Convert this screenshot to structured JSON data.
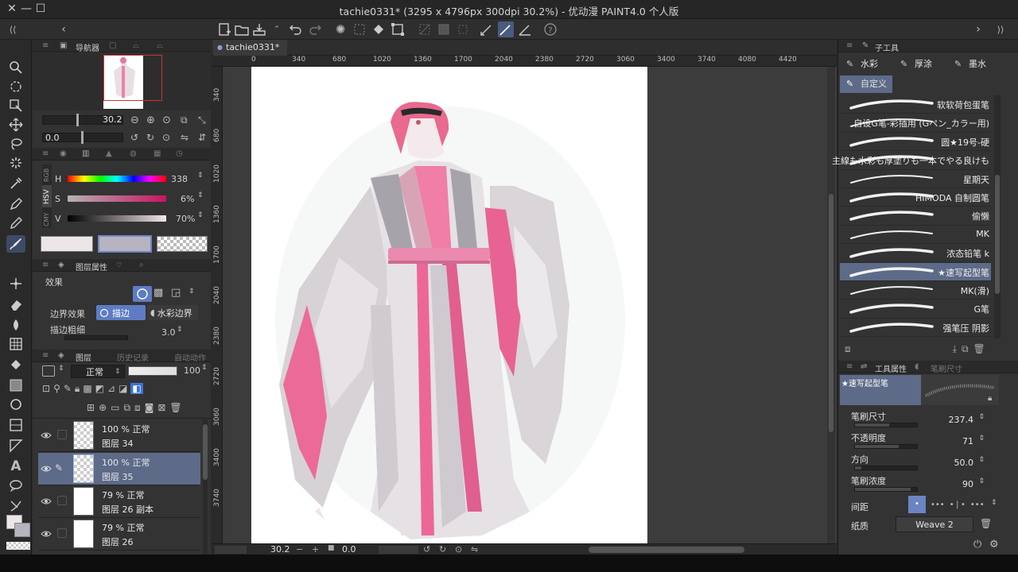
{
  "window": {
    "title": "tachie0331* (3295 x 4796px 300dpi 30.2%) - 优动漫 PAINT4.0 个人版"
  },
  "navigator": {
    "tab_label": "导航器",
    "zoom": "30.2",
    "rotation": "0.0"
  },
  "color": {
    "mode_rgb": "RGB",
    "mode_hsv": "HSV",
    "mode_cmy": "CMY",
    "h_label": "H",
    "h_value": "338",
    "s_label": "S",
    "s_value": "6%",
    "v_label": "V",
    "v_value": "70%",
    "main_color": "#ece6e8",
    "sub_color": "#b7b3bf"
  },
  "layer_props": {
    "tab_label": "图层属性",
    "effect_label": "效果",
    "border_effect_label": "边界效果",
    "opt_outline": "描边",
    "opt_watercolor": "水彩边界",
    "border_width_label": "描边粗细",
    "border_width_value": "3.0"
  },
  "layers_panel": {
    "tab_label": "图层",
    "history_label": "历史记录",
    "auto_action_label": "自动动作",
    "blend_mode": "正常",
    "opacity": "100",
    "layers": [
      {
        "opacity": "100 %  正常",
        "name": "图层 34",
        "selected": false,
        "thumb": "check"
      },
      {
        "opacity": "100 %  正常",
        "name": "图层 35",
        "selected": true,
        "thumb": "check"
      },
      {
        "opacity": "79 %  正常",
        "name": "图层 26 副本",
        "selected": false,
        "thumb": "white"
      },
      {
        "opacity": "79 %  正常",
        "name": "图层 26",
        "selected": false,
        "thumb": "white"
      }
    ]
  },
  "canvas": {
    "tab_label": "tachie0331*",
    "ruler_h": [
      "0",
      "340",
      "680",
      "1020",
      "1360",
      "1700",
      "2040",
      "2380",
      "2720",
      "3060",
      "3400",
      "3740",
      "4080",
      "4420"
    ],
    "ruler_v": [
      "340",
      "680",
      "1020",
      "1360",
      "1700",
      "2040",
      "2380",
      "2720",
      "3060",
      "3400",
      "3740"
    ],
    "zoom": "30.2",
    "rotation": "0.0"
  },
  "sub_tool": {
    "tab_label": "子工具",
    "tabs": [
      "水彩",
      "厚涂",
      "墨水",
      "自定义"
    ],
    "brushes": [
      {
        "name": "软软荷包蛋笔",
        "selected": false
      },
      {
        "name": "自设G笔-彩插用 (Gペン_カラー用)",
        "selected": false
      },
      {
        "name": "圆★19号-硬",
        "selected": false
      },
      {
        "name": "主線も水彩も厚塗りも一本でやる良けも",
        "selected": false
      },
      {
        "name": "星期天",
        "selected": false
      },
      {
        "name": "HIMODA 自制圆笔",
        "selected": false
      },
      {
        "name": "偷懒",
        "selected": false
      },
      {
        "name": "MK",
        "selected": false
      },
      {
        "name": "浓态铅笔 k",
        "selected": false
      },
      {
        "name": "★速写起型笔",
        "selected": true
      },
      {
        "name": "MK(滑)",
        "selected": false
      },
      {
        "name": "G笔",
        "selected": false
      },
      {
        "name": "强笔压 阴影",
        "selected": false
      }
    ]
  },
  "tool_props": {
    "tab_label": "工具属性",
    "tab2_label": "笔刷尺寸",
    "preset_name": "★速写起型笔",
    "props": [
      {
        "label": "笔刷尺寸",
        "value": "237.4",
        "fraction": 0.55
      },
      {
        "label": "不透明度",
        "value": "71",
        "fraction": 0.71
      },
      {
        "label": "方向",
        "value": "50.0",
        "fraction": 0.1
      },
      {
        "label": "笔刷浓度",
        "value": "90",
        "fraction": 0.9
      }
    ],
    "spacing_label": "间距",
    "texture_label": "纸质",
    "texture_value": "Weave 2"
  }
}
